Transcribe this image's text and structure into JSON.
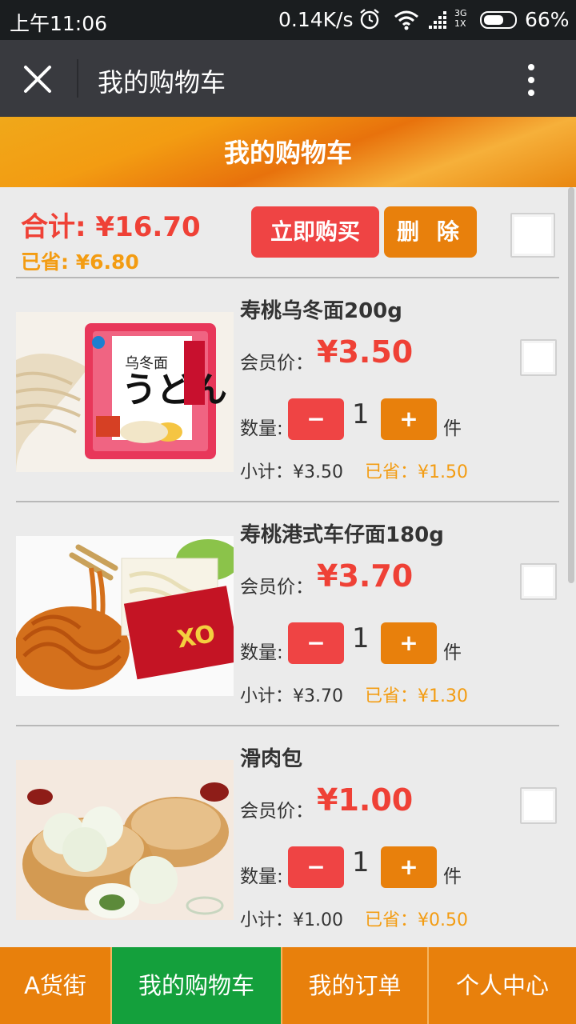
{
  "status_bar": {
    "time": "上午11:06",
    "network_speed": "0.14K/s",
    "network_type_top": "3G",
    "network_type_bottom": "1X",
    "battery_percent": "66%",
    "battery_level": 0.66
  },
  "app_bar": {
    "title": "我的购物车",
    "close_icon": "close-icon",
    "more_icon": "more-vertical-icon"
  },
  "banner": {
    "title": "我的购物车"
  },
  "summary": {
    "total": "合计: ¥16.70",
    "saved": "已省: ¥6.80",
    "buy_label": "立即购买",
    "delete_label": "删 除"
  },
  "items": [
    {
      "name": "寿桃乌冬面200g",
      "price_label": "会员价：",
      "price": "¥3.50",
      "qty_label": "数量:",
      "minus": "−",
      "qty": "1",
      "plus": "+",
      "unit": "件",
      "subtotal": "小计：¥3.50",
      "saved": "已省：¥1.50"
    },
    {
      "name": "寿桃港式车仔面180g",
      "price_label": "会员价：",
      "price": "¥3.70",
      "qty_label": "数量:",
      "minus": "−",
      "qty": "1",
      "plus": "+",
      "unit": "件",
      "subtotal": "小计：¥3.70",
      "saved": "已省：¥1.30"
    },
    {
      "name": "滑肉包",
      "price_label": "会员价：",
      "price": "¥1.00",
      "qty_label": "数量:",
      "minus": "−",
      "qty": "1",
      "plus": "+",
      "unit": "件",
      "subtotal": "小计：¥1.00",
      "saved": "已省：¥0.50"
    }
  ],
  "bottom_nav": {
    "tabs": [
      {
        "label": "A货街",
        "active": false
      },
      {
        "label": "我的购物车",
        "active": true
      },
      {
        "label": "我的订单",
        "active": false
      },
      {
        "label": "个人中心",
        "active": false
      }
    ]
  },
  "colors": {
    "accent_orange": "#e8800c",
    "price_red": "#ef4136",
    "saved_orange": "#f39c12",
    "active_tab_green": "#14a03c",
    "app_bar": "#393a3f"
  }
}
